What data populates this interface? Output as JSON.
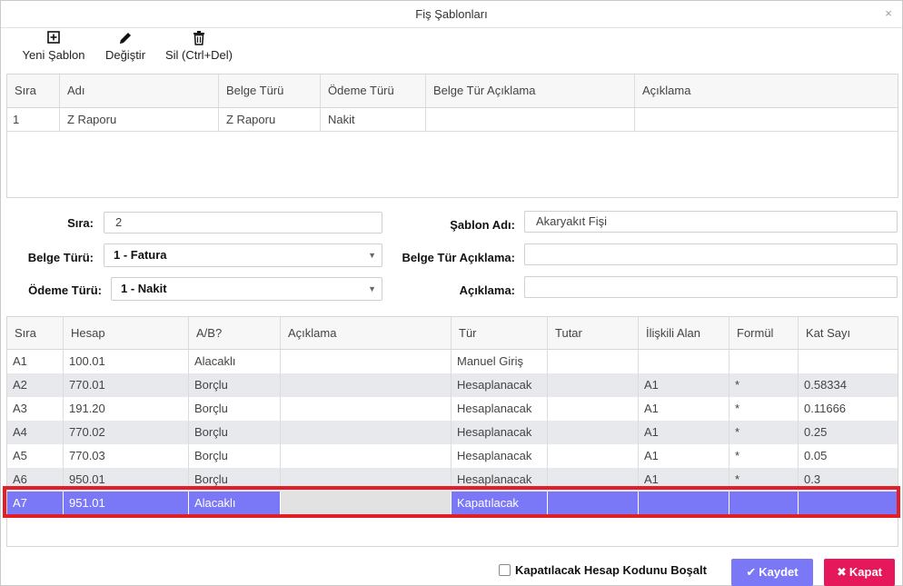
{
  "window": {
    "title": "Fiş Şablonları",
    "close_glyph": "×"
  },
  "toolbar": {
    "new": {
      "label": "Yeni Şablon",
      "icon": "plus-square-icon"
    },
    "edit": {
      "label": "Değiştir",
      "icon": "pencil-icon"
    },
    "delete": {
      "label": "Sil (Ctrl+Del)",
      "icon": "trash-icon"
    }
  },
  "templates_grid": {
    "columns": [
      "Sıra",
      "Adı",
      "Belge Türü",
      "Ödeme Türü",
      "Belge Tür Açıklama",
      "Açıklama"
    ],
    "rows": [
      [
        "1",
        "Z Raporu",
        "Z Raporu",
        "Nakit",
        "",
        ""
      ]
    ]
  },
  "form": {
    "sira_label": "Sıra:",
    "sira_value": "2",
    "belge_turu_label": "Belge Türü:",
    "belge_turu_value": "1 - Fatura",
    "odeme_turu_label": "Ödeme Türü:",
    "odeme_turu_value": "1 - Nakit",
    "sablon_adi_label": "Şablon Adı:",
    "sablon_adi_value": "Akaryakıt Fişi",
    "belge_tur_aciklama_label": "Belge Tür Açıklama:",
    "belge_tur_aciklama_value": "",
    "aciklama_label": "Açıklama:",
    "aciklama_value": ""
  },
  "lines_grid": {
    "columns": [
      "Sıra",
      "Hesap",
      "A/B?",
      "Açıklama",
      "Tür",
      "Tutar",
      "İlişkili Alan",
      "Formül",
      "Kat Sayı"
    ],
    "rows": [
      [
        "A1",
        "100.01",
        "Alacaklı",
        "",
        "Manuel Giriş",
        "",
        "",
        "",
        ""
      ],
      [
        "A2",
        "770.01",
        "Borçlu",
        "",
        "Hesaplanacak",
        "",
        "A1",
        "*",
        "0.58334"
      ],
      [
        "A3",
        "191.20",
        "Borçlu",
        "",
        "Hesaplanacak",
        "",
        "A1",
        "*",
        "0.11666"
      ],
      [
        "A4",
        "770.02",
        "Borçlu",
        "",
        "Hesaplanacak",
        "",
        "A1",
        "*",
        "0.25"
      ],
      [
        "A5",
        "770.03",
        "Borçlu",
        "",
        "Hesaplanacak",
        "",
        "A1",
        "*",
        "0.05"
      ],
      [
        "A6",
        "950.01",
        "Borçlu",
        "",
        "Hesaplanacak",
        "",
        "A1",
        "*",
        "0.3"
      ],
      [
        "A7",
        "951.01",
        "Alacaklı",
        "",
        "Kapatılacak",
        "",
        "",
        "",
        ""
      ]
    ],
    "selected_row": "A7"
  },
  "footer": {
    "checkbox_label": "Kapatılacak Hesap Kodunu Boşalt",
    "checkbox_checked": false,
    "save_label": "Kaydet",
    "close_label": "Kapat"
  },
  "colors": {
    "accent": "#7b78f7",
    "danger": "#e4185a",
    "highlight_border": "#e21f26"
  }
}
